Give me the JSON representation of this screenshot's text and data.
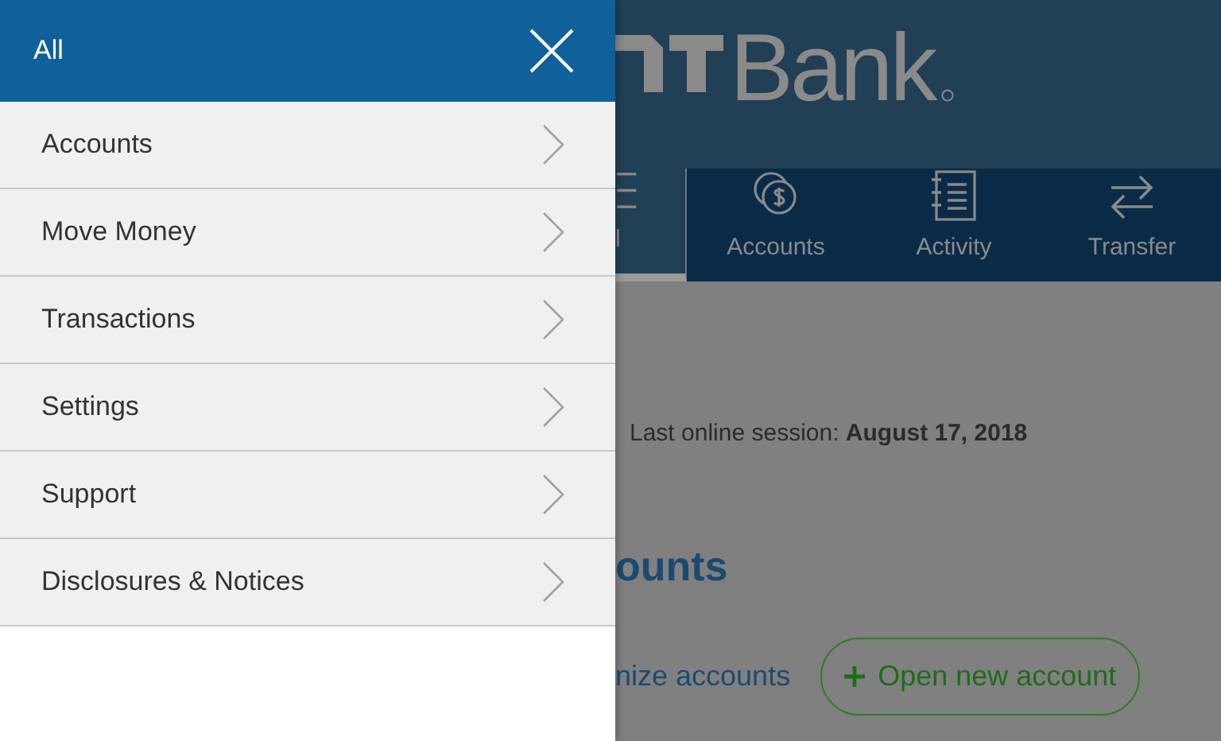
{
  "menu": {
    "title": "All",
    "items": [
      {
        "label": "Accounts"
      },
      {
        "label": "Move Money"
      },
      {
        "label": "Transactions"
      },
      {
        "label": "Settings"
      },
      {
        "label": "Support"
      },
      {
        "label": "Disclosures & Notices"
      }
    ]
  },
  "header": {
    "logo_text": "Bank"
  },
  "nav": [
    {
      "label": "l",
      "kind": "menu",
      "selected": true
    },
    {
      "label": "Accounts",
      "kind": "accounts",
      "selected": false
    },
    {
      "label": "Activity",
      "kind": "activity",
      "selected": false
    },
    {
      "label": "Transfer",
      "kind": "transfer",
      "selected": false
    }
  ],
  "session": {
    "label": "Last online session:",
    "date": "August 17, 2018"
  },
  "accounts": {
    "heading": "ounts",
    "link": "nize accounts",
    "button": "Open new account"
  }
}
